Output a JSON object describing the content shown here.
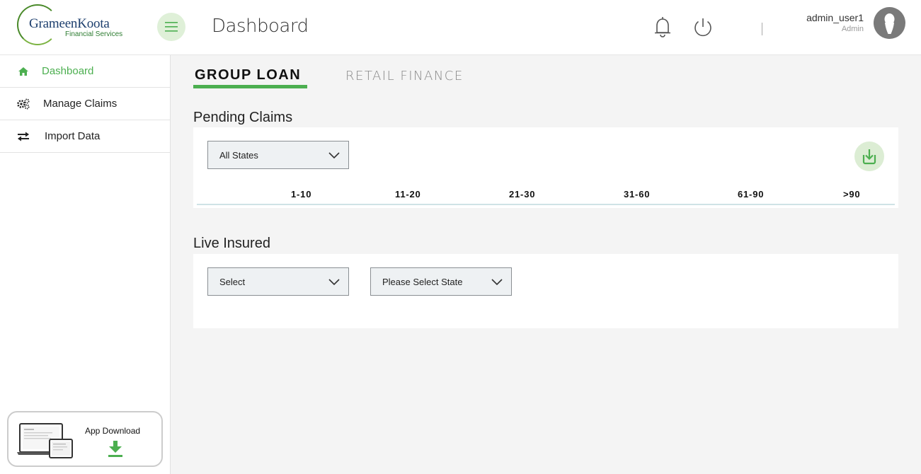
{
  "header": {
    "logo_name": "GrameenKoota",
    "logo_sub": "Financial Services",
    "page_title": "Dashboard",
    "user_name": "admin_user1",
    "user_role": "Admin"
  },
  "sidebar": {
    "items": [
      {
        "label": "Dashboard",
        "icon": "home-icon",
        "active": true
      },
      {
        "label": "Manage Claims",
        "icon": "gears-icon",
        "active": false
      },
      {
        "label": "Import Data",
        "icon": "transfer-arrows-icon",
        "active": false
      }
    ],
    "app_download_label": "App Download"
  },
  "tabs": [
    {
      "label": "GROUP LOAN",
      "active": true
    },
    {
      "label": "RETAIL FINANCE",
      "active": false
    }
  ],
  "pending_claims": {
    "title": "Pending Claims",
    "state_select": "All States",
    "columns": [
      "1-10",
      "11-20",
      "21-30",
      "31-60",
      "61-90",
      ">90"
    ]
  },
  "live_insured": {
    "title": "Live Insured",
    "select_1": "Select",
    "select_2": "Please Select State"
  },
  "colors": {
    "accent_green": "#4caf50",
    "light_green": "#dff0d8",
    "background": "#f4f4f4"
  }
}
